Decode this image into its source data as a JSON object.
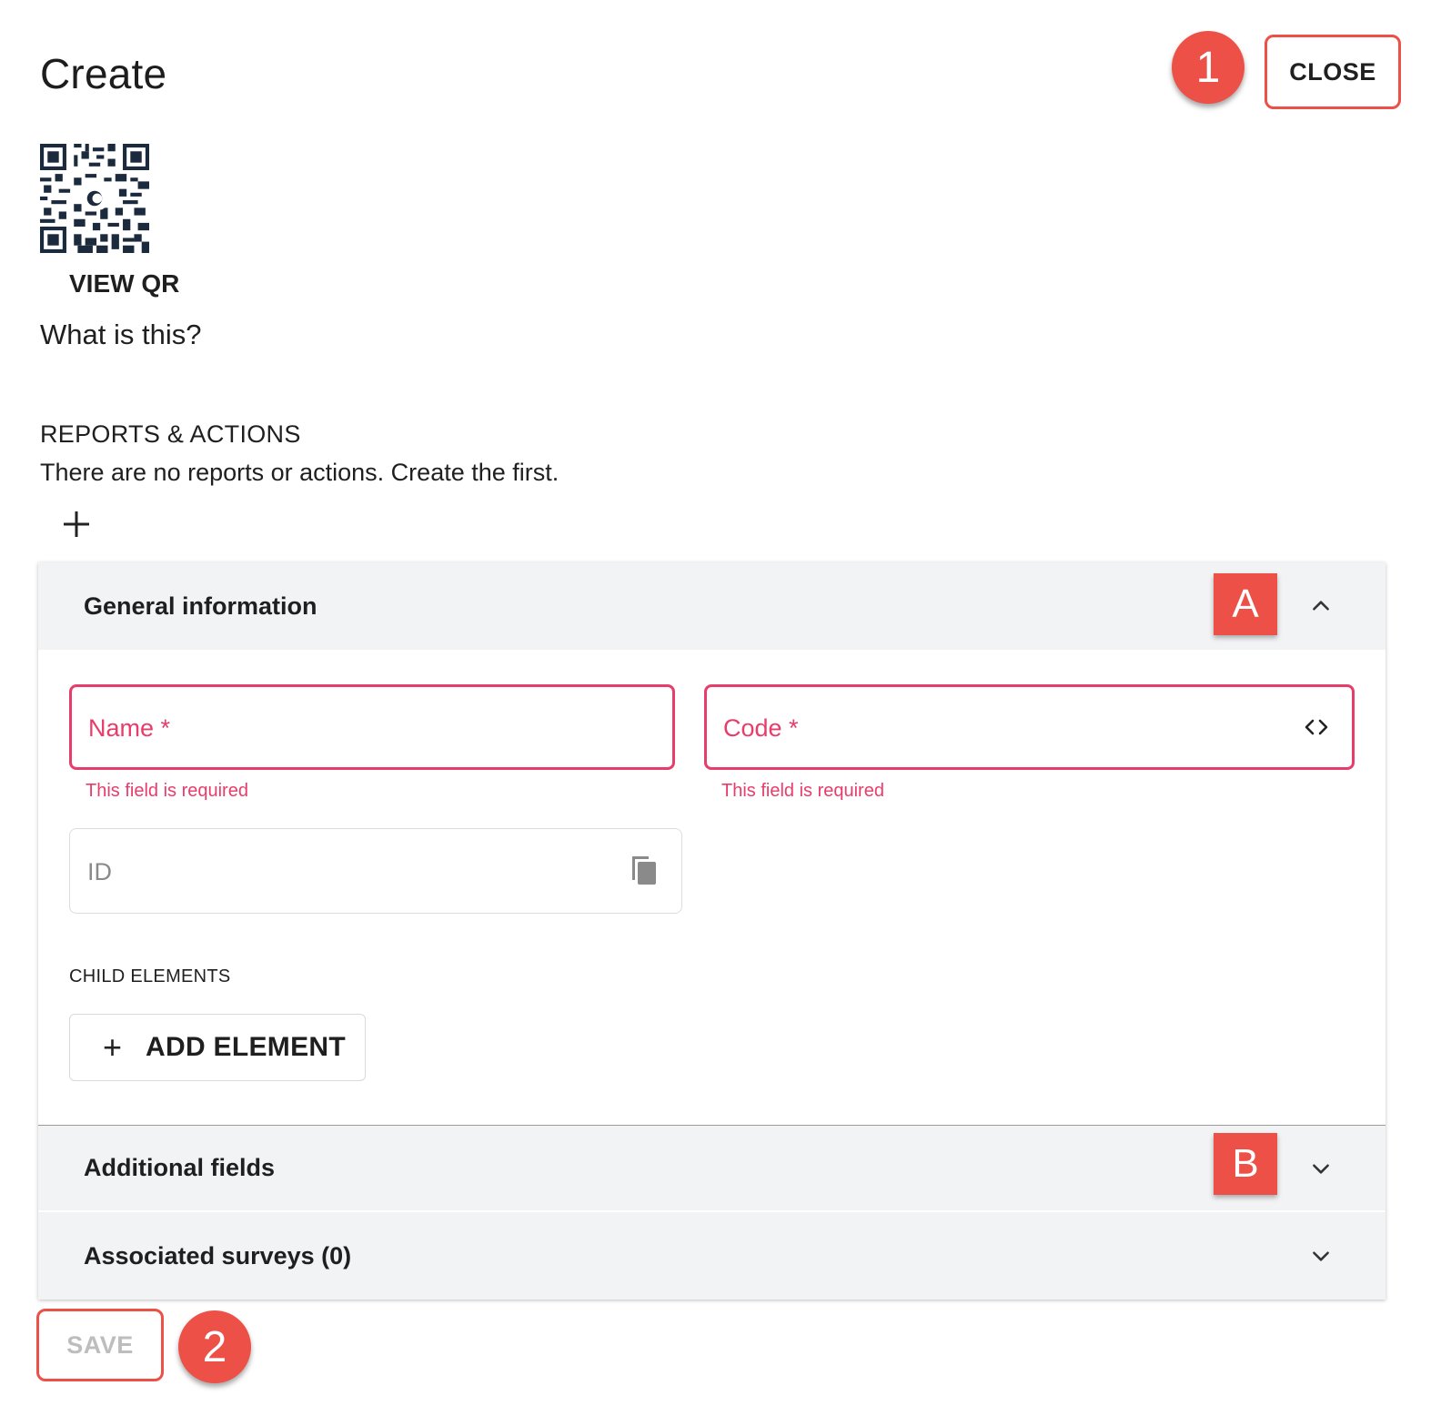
{
  "header": {
    "title": "Create",
    "close_label": "CLOSE",
    "marker_1": "1"
  },
  "qr": {
    "label": "VIEW QR",
    "icon": "qr-code-icon"
  },
  "help_link": "What is this?",
  "reports": {
    "title": "REPORTS & ACTIONS",
    "empty_text": "There are no reports or actions. Create the first.",
    "add_icon": "plus-icon"
  },
  "general": {
    "title": "General information",
    "marker": "A",
    "expanded": true,
    "name_label": "Name *",
    "name_error": "This field is required",
    "code_label": "Code *",
    "code_error": "This field is required",
    "code_icon": "code-icon",
    "id_placeholder": "ID",
    "id_icon": "copy-icon",
    "child_elements_title": "CHILD ELEMENTS",
    "add_element_label": "ADD ELEMENT"
  },
  "additional": {
    "title": "Additional fields",
    "marker": "B",
    "expanded": false
  },
  "surveys": {
    "title": "Associated surveys (0)",
    "expanded": false
  },
  "footer": {
    "save_label": "SAVE",
    "marker_2": "2"
  },
  "colors": {
    "accent_marker": "#ec5047",
    "error": "#e83c6b",
    "accordion_bg": "#f2f3f5",
    "qr_dark": "#1b2a3d"
  }
}
